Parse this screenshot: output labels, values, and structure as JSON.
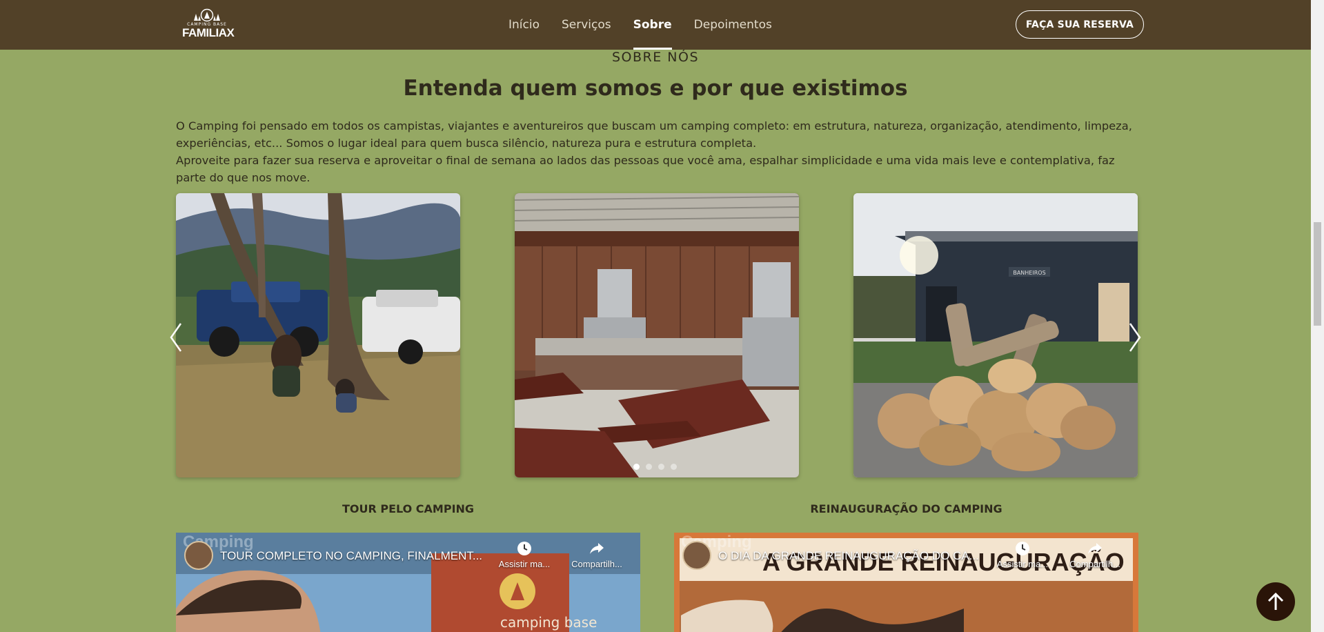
{
  "header": {
    "logo_sub": "CAMPING BASE",
    "logo_name": "FAMILIAX",
    "nav": [
      {
        "label": "Início",
        "active": false
      },
      {
        "label": "Serviços",
        "active": false
      },
      {
        "label": "Sobre",
        "active": true
      },
      {
        "label": "Depoimentos",
        "active": false
      }
    ],
    "cta_label": "FAÇA SUA RESERVA"
  },
  "about": {
    "eyebrow": "SOBRE NÓS",
    "title": "Entenda quem somos e por que existimos",
    "paragraph1": "O Camping foi pensado em todos os campistas, viajantes e aventureiros que buscam um camping completo: em estrutura, natureza, organização, atendimento, limpeza, experiências, etc... Somos o lugar ideal para quem busca silêncio, natureza pura e estrutura completa.",
    "paragraph2": "Aproveite para fazer sua reserva e aproveitar o final de semana ao lados das pessoas que você ama, espalhar simplicidade e uma vida mais leve e contemplativa, faz parte do que nos move."
  },
  "carousel": {
    "slides": [
      {
        "name": "family-under-tree-photo",
        "icon": "photo"
      },
      {
        "name": "barbecue-kiosk-photo",
        "icon": "photo"
      },
      {
        "name": "campfire-bathrooms-photo",
        "icon": "photo",
        "sign_text": "BANHEIROS"
      }
    ],
    "dot_count": 4,
    "active_dot": 0
  },
  "videos": [
    {
      "label": "TOUR PELO CAMPING",
      "title": "TOUR COMPLETO NO CAMPING, FINALMENT...",
      "watch_later": "Assistir ma...",
      "share": "Compartilh...",
      "brand": "Camping",
      "overlay_text": "camping base"
    },
    {
      "label": "REINAUGURAÇÃO DO CAMPING",
      "title": "O DIA DA GRANDE REINAUGURAÇÃO DO CA...",
      "watch_later": "Assistir ma...",
      "share": "Compartilh...",
      "brand": "Camping",
      "overlay_text": "A GRANDE REINAUGURAÇÃO"
    }
  ],
  "colors": {
    "header_bg": "#524128",
    "page_bg": "#95a864",
    "text": "#2f2a1c",
    "back_to_top_bg": "#2a1408"
  }
}
